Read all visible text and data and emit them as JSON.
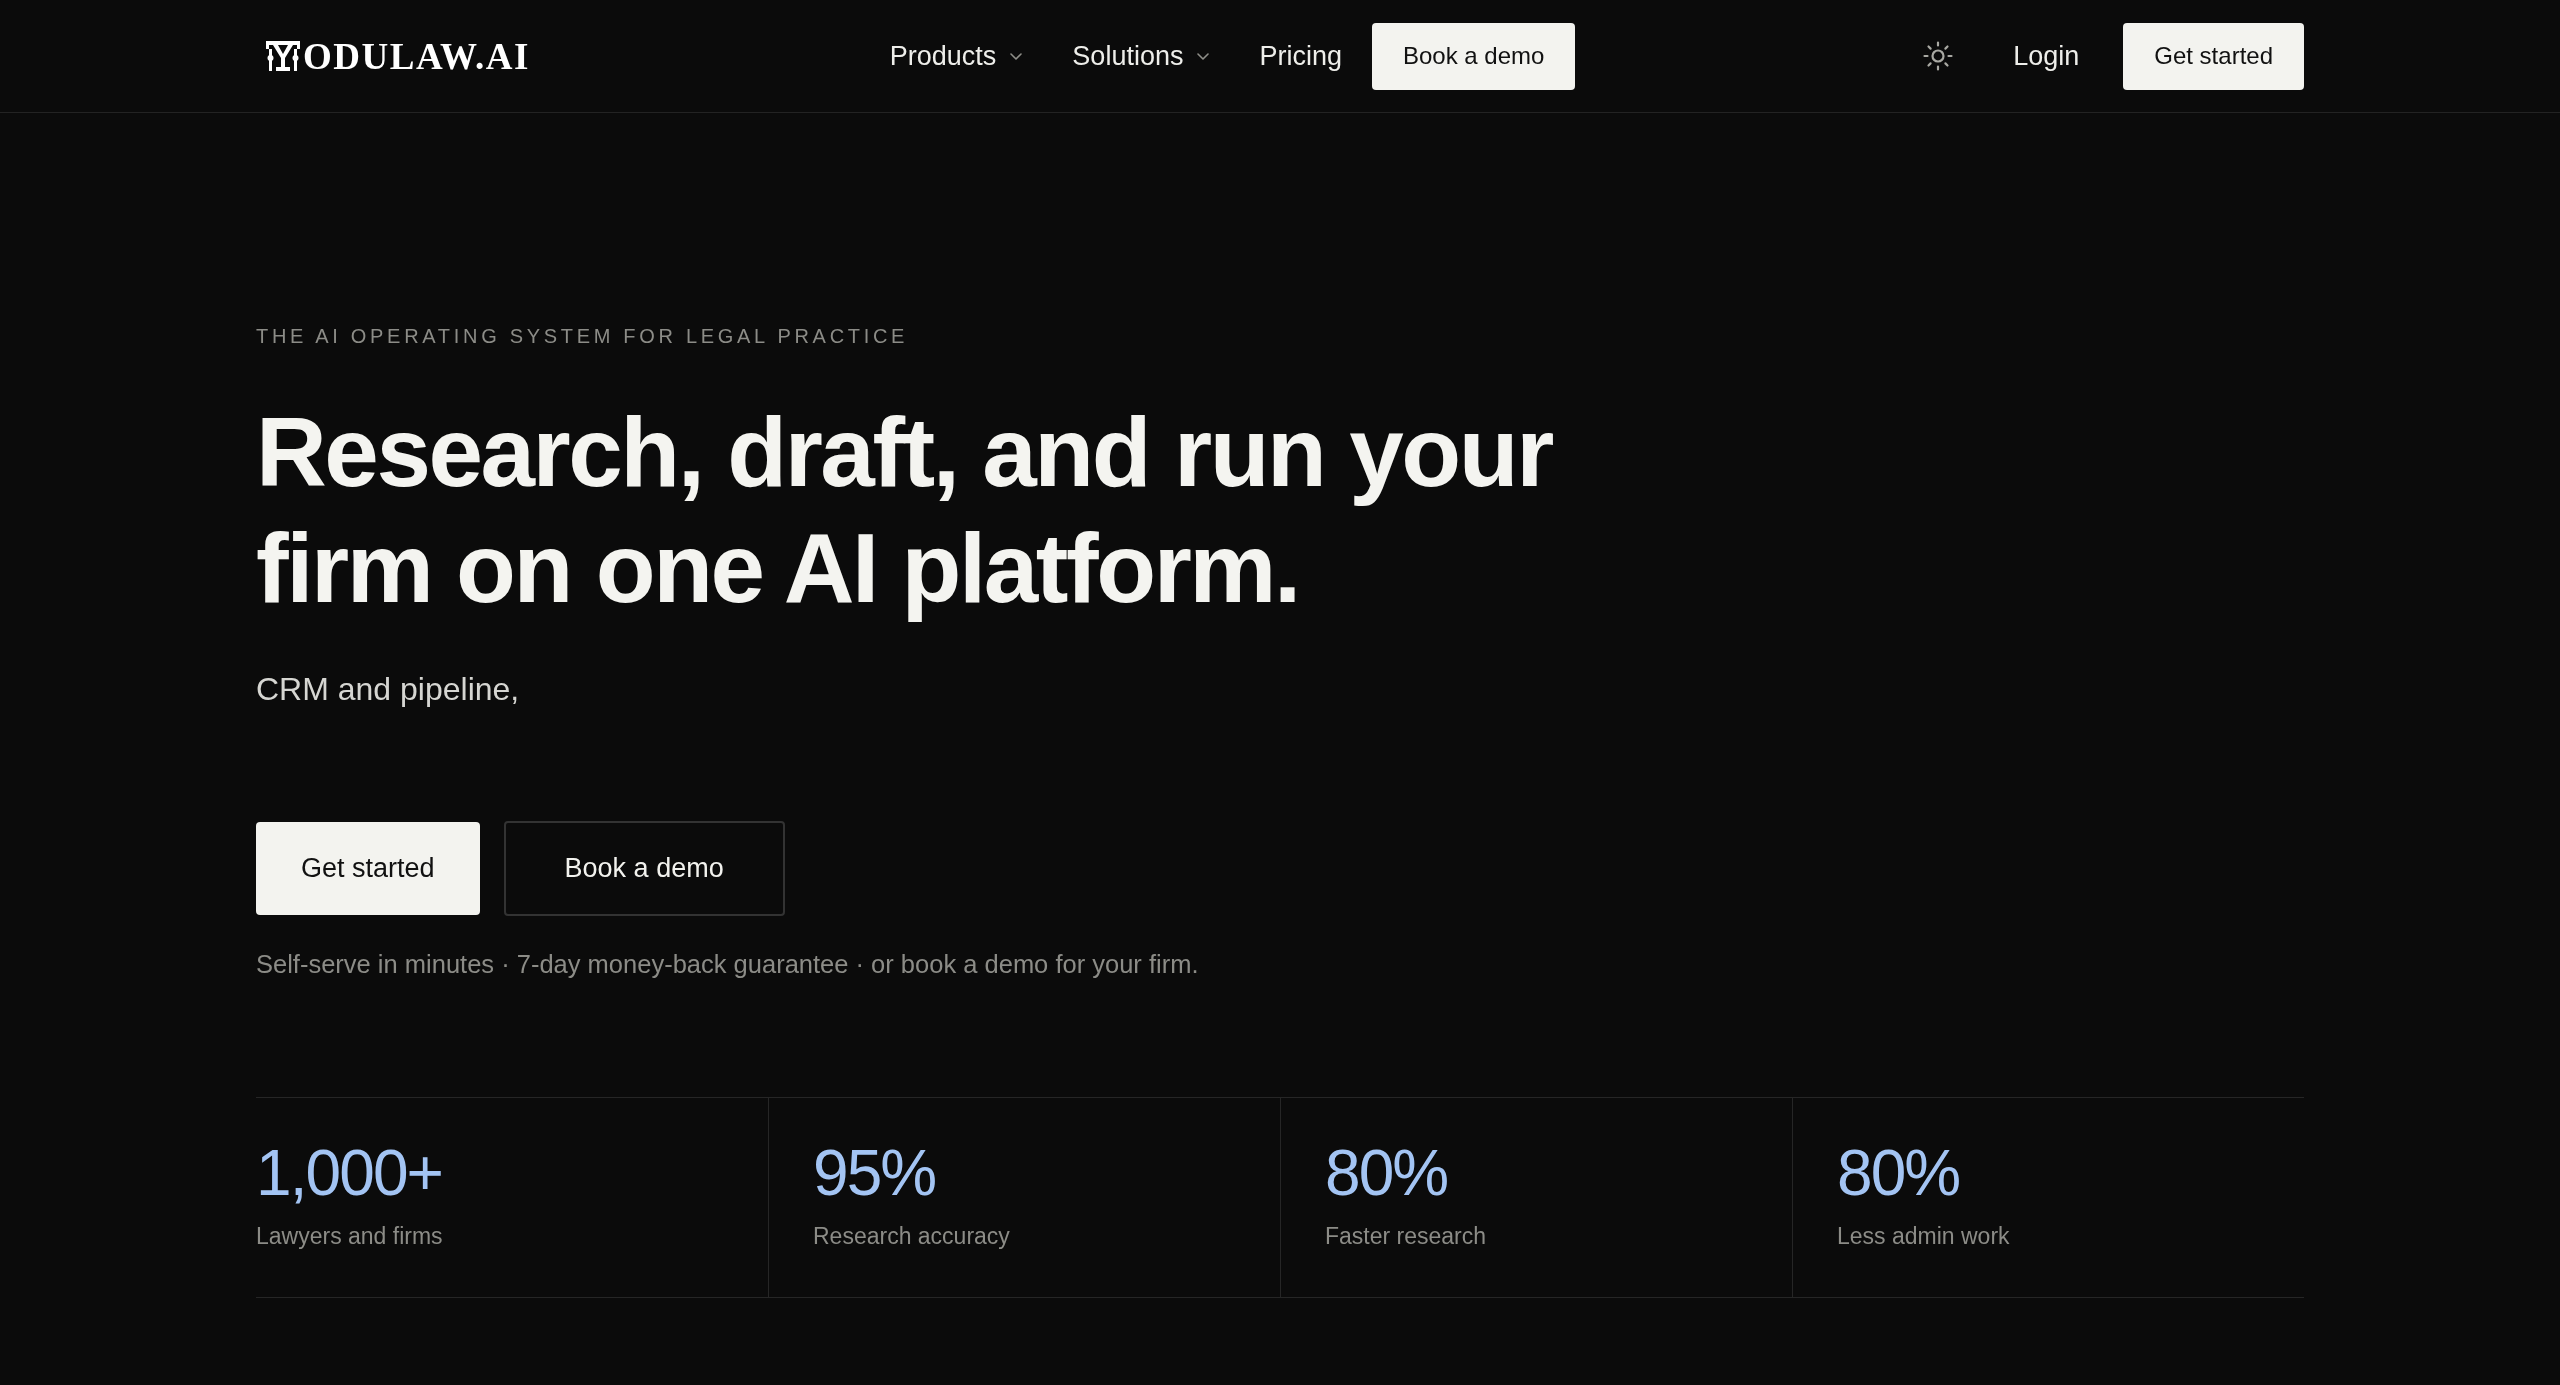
{
  "header": {
    "logo": {
      "text": "ODULAW.AI"
    },
    "nav": [
      {
        "label": "Products",
        "kind": "dropdown"
      },
      {
        "label": "Solutions",
        "kind": "dropdown"
      },
      {
        "label": "Pricing",
        "kind": "link"
      },
      {
        "label": "Book a demo",
        "kind": "button"
      }
    ],
    "actions": [
      {
        "kind": "theme-toggle"
      },
      {
        "kind": "link",
        "label": "Login"
      },
      {
        "kind": "button",
        "label": "Get started"
      }
    ]
  },
  "hero": {
    "eyebrow": "THE AI OPERATING SYSTEM FOR LEGAL PRACTICE",
    "headline": "Research, draft, and run your firm on one AI platform.",
    "subtitle": "CRM and pipeline,",
    "buttons": [
      {
        "label": "Get started",
        "kind": "primary"
      },
      {
        "label": "Book a demo",
        "kind": "secondary"
      }
    ],
    "note": "Self-serve in minutes · 7-day money-back guarantee · or book a demo for your firm."
  },
  "stats": [
    {
      "value": "1,000+",
      "label": "Lawyers and firms"
    },
    {
      "value": "95%",
      "label": "Research accuracy"
    },
    {
      "value": "80%",
      "label": "Faster research"
    },
    {
      "value": "80%",
      "label": "Less admin work"
    }
  ]
}
